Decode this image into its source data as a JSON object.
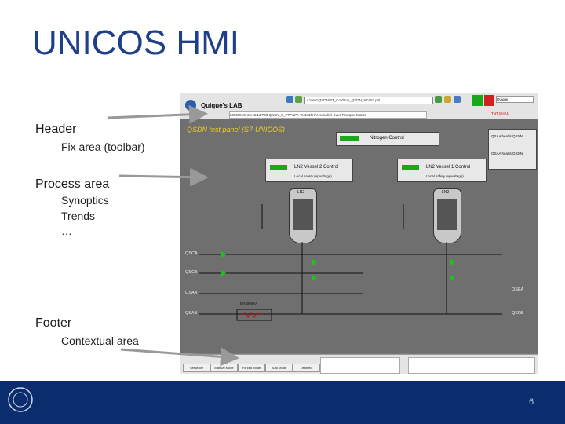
{
  "slide": {
    "title": "UNICOS HMI",
    "labels": {
      "header": "Header",
      "header_sub": "Fix area (toolbar)",
      "process": "Process area",
      "process_subs": [
        "Synoptics",
        "Trends",
        "…"
      ],
      "footer": "Footer",
      "footer_sub": "Contextual area"
    },
    "page_number": "6",
    "colors": {
      "title": "#1f3f86",
      "footer_band": "#0b2d6e",
      "panel_title": "#f0d020"
    }
  },
  "screenshot": {
    "toolbar": {
      "app_title": "Quique's LAB",
      "path_value": "c:\\cern\\QSDN\\PT_ColdBox_QSDN_S7-\\S7.pnl",
      "info_text": "2006/CUS 06:46:13:743  QSCN_S_PTP&PA  Texte&N Personalisé avec Pratique Status",
      "user": "Quique",
      "alarm_text": "TNT OHAS"
    },
    "process": {
      "panel_title": "QSDN test panel (S7-UNICOS)",
      "nitrogen_control": "Nitrogen Control",
      "vessel2": "LN2 Vessel 2 Control",
      "vessel1": "LN2 Vessel 1 Control",
      "local_safety": "Local safety (upvoltage)",
      "tank_label": "LN2",
      "qsaa_heads_qsdn": "QSAA heads QSDN",
      "qsaa_heads_qsdn2": "QSAA heads QSDN",
      "left_lines": [
        "QSCA",
        "QSCB",
        "QSAA",
        "QSAB"
      ],
      "right_lines": [
        "QSKA",
        "QSRB"
      ],
      "heater_label": "EH4004AA"
    },
    "context": {
      "buttons": [
        "Set Mode",
        "Manual Mode",
        "Forced Mode",
        "Auto Mode",
        "Deselect"
      ]
    }
  }
}
